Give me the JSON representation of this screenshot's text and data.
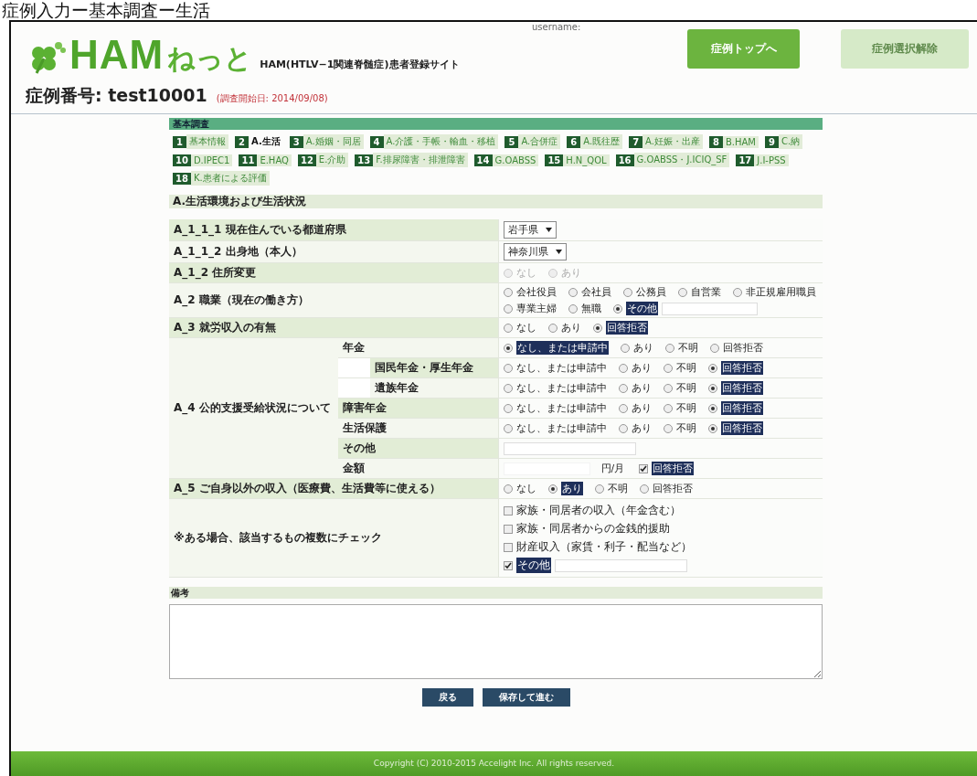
{
  "caption": "症例入力ー基本調査ー生活",
  "header": {
    "logo_main": "HAM",
    "logo_sub": "ねっと",
    "subtitle": "HAM(HTLV−1関連脊髄症)患者登録サイト",
    "username_label": "username:",
    "buttons": [
      {
        "label": "症例トップへ",
        "disabled": false
      },
      {
        "label": "症例選択解除",
        "disabled": true
      }
    ],
    "case_number": "症例番号: test10001",
    "survey_date": "(調査開始日: 2014/09/08)"
  },
  "section_title": "基本調査",
  "tab_rows": [
    [
      {
        "number": "1",
        "label": "基本情報",
        "selected": false
      },
      {
        "number": "2",
        "label": "A.生活",
        "selected": true
      },
      {
        "number": "3",
        "label": "A.婚姻・同居",
        "selected": false
      },
      {
        "number": "4",
        "label": "A.介護・手帳・輸血・移植",
        "selected": false
      },
      {
        "number": "5",
        "label": "A.合併症",
        "selected": false
      },
      {
        "number": "6",
        "label": "A.既往歴",
        "selected": false
      },
      {
        "number": "7",
        "label": "A.妊娠・出産",
        "selected": false
      },
      {
        "number": "8",
        "label": "B.HAM",
        "selected": false
      },
      {
        "number": "9",
        "label": "C.納",
        "selected": false
      }
    ],
    [
      {
        "number": "10",
        "label": "D.IPEC1",
        "selected": false
      },
      {
        "number": "11",
        "label": "E.HAQ",
        "selected": false
      },
      {
        "number": "12",
        "label": "E.介助",
        "selected": false
      },
      {
        "number": "13",
        "label": "F.排尿障害・排泄障害",
        "selected": false
      },
      {
        "number": "14",
        "label": "G.OABSS",
        "selected": false
      },
      {
        "number": "15",
        "label": "H.N_QOL",
        "selected": false
      },
      {
        "number": "16",
        "label": "G.OABSS・J.ICIQ_SF",
        "selected": false
      },
      {
        "number": "17",
        "label": "J.I-PSS",
        "selected": false
      }
    ],
    [
      {
        "number": "18",
        "label": "K.患者による評価",
        "selected": false
      }
    ]
  ],
  "subsection_title": "A.生活環境および生活状況",
  "rows": [
    {
      "kind": "select",
      "label": "A_1_1_1 現在住んでいる都道府県",
      "value": "岩手県"
    },
    {
      "kind": "select",
      "label": "A_1_1_2 出身地（本人）",
      "value": "神奈川県"
    },
    {
      "kind": "radio",
      "label": "A_1_2 住所変更",
      "disabled": true,
      "options": [
        {
          "label": "なし",
          "selected": false
        },
        {
          "label": "あり",
          "selected": false
        }
      ]
    },
    {
      "kind": "radio",
      "label": "A_2 職業（現在の働き方）",
      "disabled": false,
      "options": [
        {
          "label": "会社役員",
          "selected": false
        },
        {
          "label": "会社員",
          "selected": false
        },
        {
          "label": "公務員",
          "selected": false
        },
        {
          "label": "自営業",
          "selected": false
        },
        {
          "label": "非正規雇用職員",
          "selected": false
        },
        {
          "label": "専業主婦",
          "selected": false
        },
        {
          "label": "無職",
          "selected": false
        },
        {
          "label": "その他",
          "selected": true,
          "has_input": true
        }
      ]
    },
    {
      "kind": "radio",
      "label": "A_3 就労収入の有無",
      "disabled": false,
      "options": [
        {
          "label": "なし",
          "selected": false
        },
        {
          "label": "あり",
          "selected": false
        },
        {
          "label": "回答拒否",
          "selected": true
        }
      ]
    },
    {
      "kind": "group",
      "label": "A_4 公的支援受給状況について",
      "items": [
        {
          "kind": "radio",
          "label": "年金",
          "options": [
            {
              "label": "なし、または申請中",
              "selected": true
            },
            {
              "label": "あり",
              "selected": false
            },
            {
              "label": "不明",
              "selected": false
            },
            {
              "label": "回答拒否",
              "selected": false
            }
          ],
          "children": [
            {
              "kind": "radio",
              "label": "国民年金・厚生年金",
              "options": [
                {
                  "label": "なし、または申請中",
                  "selected": false
                },
                {
                  "label": "あり",
                  "selected": false
                },
                {
                  "label": "不明",
                  "selected": false
                },
                {
                  "label": "回答拒否",
                  "selected": true
                }
              ]
            },
            {
              "kind": "radio",
              "label": "遺族年金",
              "options": [
                {
                  "label": "なし、または申請中",
                  "selected": false
                },
                {
                  "label": "あり",
                  "selected": false
                },
                {
                  "label": "不明",
                  "selected": false
                },
                {
                  "label": "回答拒否",
                  "selected": true
                }
              ]
            }
          ]
        },
        {
          "kind": "radio",
          "label": "障害年金",
          "options": [
            {
              "label": "なし、または申請中",
              "selected": false
            },
            {
              "label": "あり",
              "selected": false
            },
            {
              "label": "不明",
              "selected": false
            },
            {
              "label": "回答拒否",
              "selected": true
            }
          ]
        },
        {
          "kind": "radio",
          "label": "生活保護",
          "options": [
            {
              "label": "なし、または申請中",
              "selected": false
            },
            {
              "label": "あり",
              "selected": false
            },
            {
              "label": "不明",
              "selected": false
            },
            {
              "label": "回答拒否",
              "selected": true
            }
          ]
        },
        {
          "kind": "text",
          "label": "その他"
        },
        {
          "kind": "amount",
          "label": "金額",
          "unit": "円/月",
          "refusal": {
            "label": "回答拒否",
            "checked": true
          }
        }
      ]
    },
    {
      "kind": "radio",
      "label": "A_5 ご自身以外の収入（医療費、生活費等に使える）",
      "disabled": false,
      "options": [
        {
          "label": "なし",
          "selected": false
        },
        {
          "label": "あり",
          "selected": true
        },
        {
          "label": "不明",
          "selected": false
        },
        {
          "label": "回答拒否",
          "selected": false
        }
      ]
    },
    {
      "kind": "checkboxes",
      "label": "※ある場合、該当するもの複数にチェック",
      "options": [
        {
          "label": "家族・同居者の収入（年金含む）",
          "checked": false
        },
        {
          "label": "家族・同居者からの金銭的援助",
          "checked": false
        },
        {
          "label": "財産収入（家賃・利子・配当など）",
          "checked": false
        },
        {
          "label": "その他",
          "checked": true,
          "has_input": true
        }
      ]
    }
  ],
  "remarks_title": "備考",
  "actions": [
    "戻る",
    "保存して進む"
  ],
  "footer": "Copyright (C) 2010-2015 Accelight Inc. All rights reserved."
}
